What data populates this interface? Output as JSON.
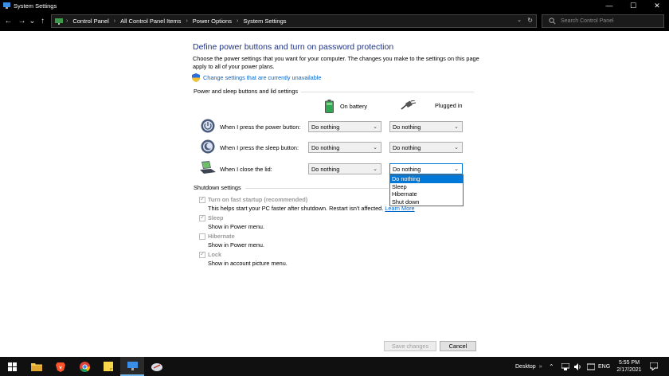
{
  "window": {
    "title": "System Settings",
    "controls": {
      "minimize": "—",
      "maximize": "☐",
      "close": "✕"
    }
  },
  "address": {
    "nav": {
      "back": "←",
      "forward": "→",
      "recent": "⌄",
      "up": "↑"
    },
    "breadcrumbs": [
      "Control Panel",
      "All Control Panel Items",
      "Power Options",
      "System Settings"
    ],
    "separator": "›",
    "dropdown": "⌄",
    "refresh": "↻",
    "search_placeholder": "Search Control Panel"
  },
  "page": {
    "heading": "Define power buttons and turn on password protection",
    "description": "Choose the power settings that you want for your computer. The changes you make to the settings on this page apply to all of your power plans.",
    "admin_link": "Change settings that are currently unavailable",
    "power_section": "Power and sleep buttons and lid settings",
    "columns": {
      "battery": "On battery",
      "plugged": "Plugged in"
    },
    "rows": [
      {
        "label": "When I press the power button:",
        "battery": "Do nothing",
        "plugged": "Do nothing"
      },
      {
        "label": "When I press the sleep button:",
        "battery": "Do nothing",
        "plugged": "Do nothing"
      },
      {
        "label": "When I close the lid:",
        "battery": "Do nothing",
        "plugged": "Do nothing"
      }
    ],
    "dropdown_options": [
      "Do nothing",
      "Sleep",
      "Hibernate",
      "Shut down"
    ],
    "dropdown_selected": "Do nothing",
    "shutdown_section": "Shutdown settings",
    "shutdown_options": [
      {
        "title": "Turn on fast startup (recommended)",
        "desc": "This helps start your PC faster after shutdown. Restart isn't affected.",
        "link": "Learn More",
        "checked": true
      },
      {
        "title": "Sleep",
        "desc": "Show in Power menu.",
        "checked": true
      },
      {
        "title": "Hibernate",
        "desc": "Show in Power menu.",
        "checked": false
      },
      {
        "title": "Lock",
        "desc": "Show in account picture menu.",
        "checked": true
      }
    ]
  },
  "buttons": {
    "save": "Save changes",
    "cancel": "Cancel"
  },
  "taskbar": {
    "desktop_label": "Desktop",
    "language": "ENG",
    "time": "5:55 PM",
    "date": "2/17/2021"
  },
  "colors": {
    "heading": "#1e3287",
    "link": "#0066cc",
    "selection": "#0078d7"
  }
}
